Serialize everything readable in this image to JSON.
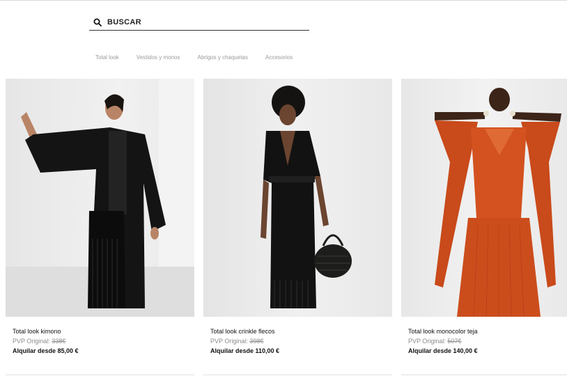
{
  "search": {
    "label": "BUSCAR"
  },
  "categories": [
    "Total look",
    "Vestidos y monos",
    "Abrigos y chaquetas",
    "Accesorios"
  ],
  "products": [
    {
      "name": "Total look kimono",
      "original_label": "PVP Original:",
      "original_price": "338€",
      "rent_label": "Alquilar desde 85,00 €"
    },
    {
      "name": "Total look crinkle flecos",
      "original_label": "PVP Original:",
      "original_price": "398€",
      "rent_label": "Alquilar desde 110,00 €"
    },
    {
      "name": "Total look monocolor teja",
      "original_label": "PVP Original:",
      "original_price": "507€",
      "rent_label": "Alquilar desde 140,00 €"
    }
  ],
  "colors": {
    "outfit_orange": "#d3521f",
    "outfit_black": "#141414"
  },
  "icons": {
    "search": "search-icon"
  }
}
